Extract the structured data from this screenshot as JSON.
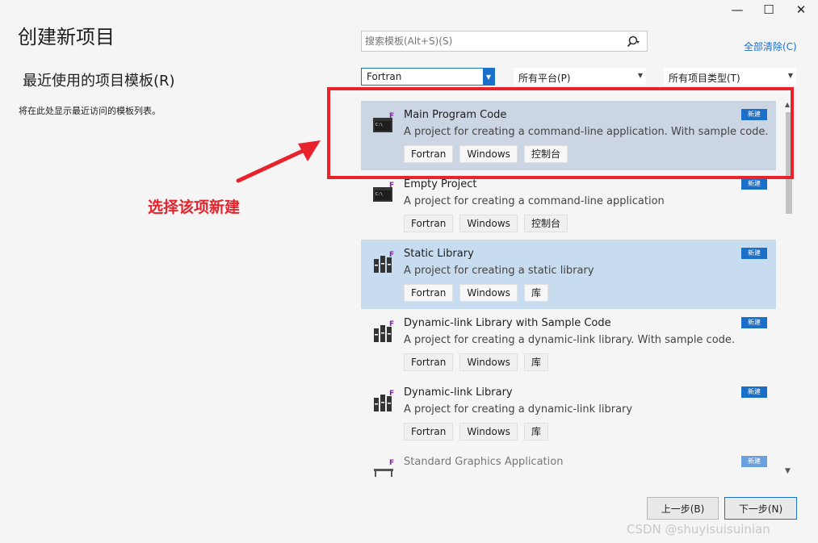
{
  "window": {
    "title": "创建新项目",
    "controls": {
      "minimize": "—",
      "maximize": "☐",
      "close": "✕"
    }
  },
  "recent": {
    "title": "最近使用的项目模板(R)",
    "empty_text": "将在此处显示最近访问的模板列表。"
  },
  "search": {
    "placeholder": "搜索模板(Alt+S)(S)",
    "clear_all": "全部清除(C)"
  },
  "filters": {
    "language": "Fortran",
    "platform": "所有平台(P)",
    "project_type": "所有项目类型(T)"
  },
  "templates": [
    {
      "name": "Main Program Code",
      "description": "A project for creating a command-line application. With sample code.",
      "tags": [
        "Fortran",
        "Windows",
        "控制台"
      ],
      "badge": "新建",
      "icon": "console-app-icon",
      "state": "hover"
    },
    {
      "name": "Empty Project",
      "description": "A project for creating a command-line application",
      "tags": [
        "Fortran",
        "Windows",
        "控制台"
      ],
      "badge": "新建",
      "icon": "console-app-icon",
      "state": "normal"
    },
    {
      "name": "Static Library",
      "description": "A project for creating a static library",
      "tags": [
        "Fortran",
        "Windows",
        "库"
      ],
      "badge": "新建",
      "icon": "library-icon",
      "state": "selected"
    },
    {
      "name": "Dynamic-link Library with Sample Code",
      "description": "A project for creating a dynamic-link library. With sample code.",
      "tags": [
        "Fortran",
        "Windows",
        "库"
      ],
      "badge": "新建",
      "icon": "library-icon",
      "state": "normal"
    },
    {
      "name": "Dynamic-link Library",
      "description": "A project for creating a dynamic-link library",
      "tags": [
        "Fortran",
        "Windows",
        "库"
      ],
      "badge": "新建",
      "icon": "library-icon",
      "state": "normal"
    },
    {
      "name": "Standard Graphics Application",
      "description": "",
      "tags": [],
      "badge": "新建",
      "icon": "graphics-app-icon",
      "state": "faded"
    }
  ],
  "annotation": {
    "text": "选择该项新建",
    "color": "#e8232c"
  },
  "buttons": {
    "back": "上一步(B)",
    "next": "下一步(N)"
  },
  "watermark": "CSDN @shuyisuisuinian",
  "colors": {
    "accent": "#1a6fc9",
    "hover_row": "#ccd5e3",
    "selected_row": "#c8dcf0"
  }
}
